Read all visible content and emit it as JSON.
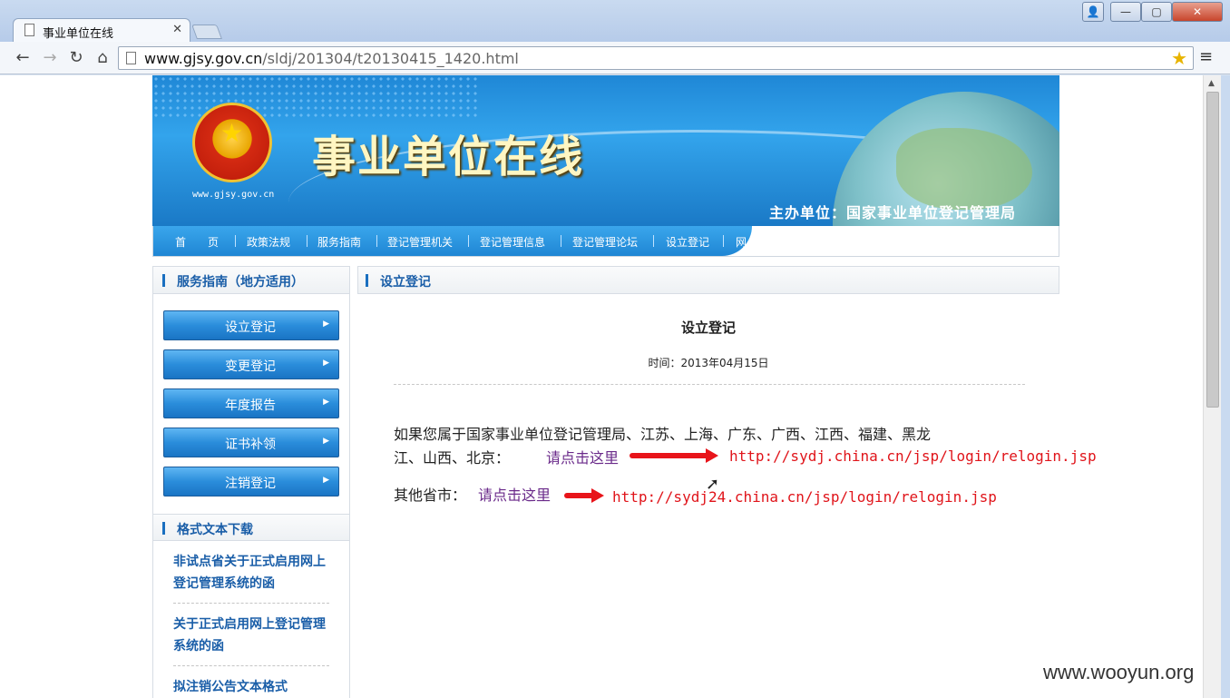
{
  "browser": {
    "tab_title": "事业单位在线",
    "tab_close": "✕",
    "url_host": "www.gjsy.gov.cn",
    "url_path": "/sldj/201304/t20130415_1420.html",
    "back": "←",
    "forward": "→",
    "reload": "↻",
    "home": "⌂",
    "star": "★",
    "menu": "≡",
    "window": {
      "min": "—",
      "max": "▢",
      "close": "✕",
      "user": "👤"
    }
  },
  "banner": {
    "site_url": "www.gjsy.gov.cn",
    "title": "事业单位在线",
    "sponsor": "主办单位：国家事业单位登记管理局",
    "emblem_icon": "★"
  },
  "nav": {
    "items": [
      "首　　页",
      "政策法规",
      "服务指南",
      "登记管理机关",
      "登记管理信息",
      "登记管理论坛",
      "设立登记",
      "网上登"
    ]
  },
  "sidebar": {
    "guide_title": "服务指南（地方适用）",
    "buttons": [
      "设立登记",
      "变更登记",
      "年度报告",
      "证书补领",
      "注销登记"
    ],
    "arrow": "▶",
    "docs_title": "格式文本下载",
    "docs": [
      {
        "line1": "非试点省关于正式启用网上",
        "line2": "登记管理系统的函"
      },
      {
        "line1": "关于正式启用网上登记管理",
        "line2": "系统的函"
      },
      {
        "line1": "拟注销公告文本格式",
        "line2": ""
      }
    ]
  },
  "main": {
    "section_title": "设立登记",
    "article_title": "设立登记",
    "time": "时间：2013年04月15日",
    "para1_line1": "如果您属于国家事业单位登记管理局、江苏、上海、广东、广西、江西、福建、黑龙",
    "para1_line2": "江、山西、北京：",
    "link1": "请点击这里",
    "url1": "http://sydj.china.cn/jsp/login/relogin.jsp",
    "para2": "其他省市：",
    "link2": "请点击这里",
    "url2": "http://sydj24.china.cn/jsp/login/relogin.jsp"
  },
  "watermark": "www.wooyun.org",
  "colors": {
    "accent": "#1f86d4",
    "link": "#6a2a8a",
    "annotation": "#e0141a"
  }
}
